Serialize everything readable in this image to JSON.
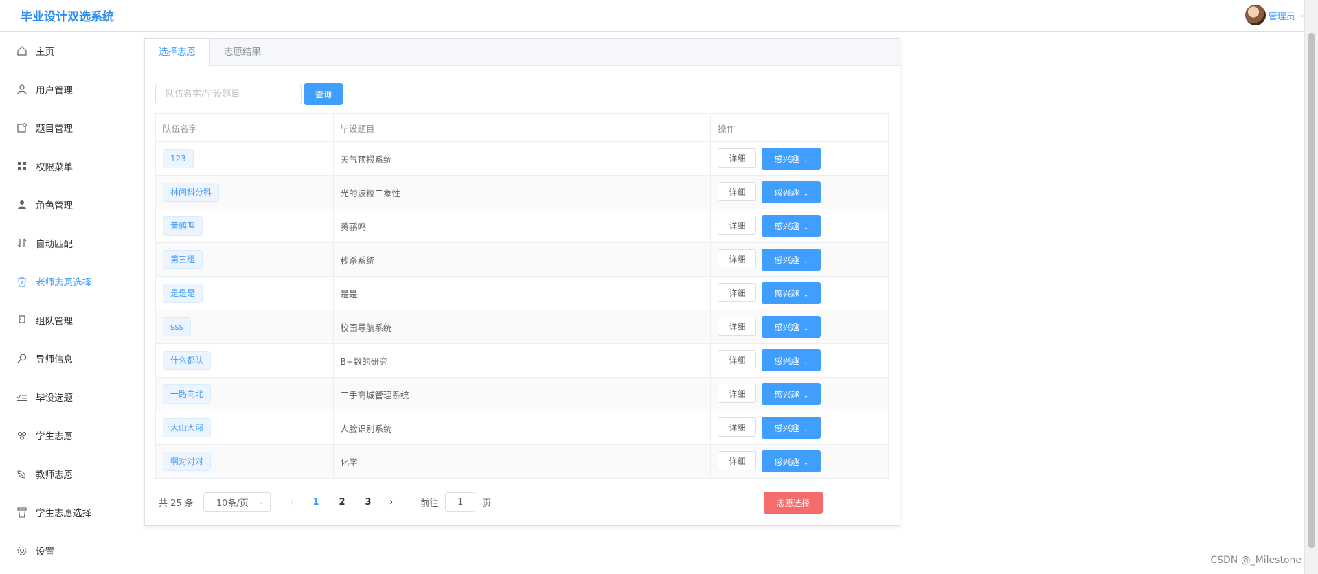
{
  "header": {
    "app_title": "毕业设计双选系统",
    "user_name": "管理员",
    "user_caret_icon": "chevron-down-icon"
  },
  "sidebar": {
    "items": [
      {
        "label": "主页",
        "icon": "home-icon"
      },
      {
        "label": "用户管理",
        "icon": "user-icon"
      },
      {
        "label": "题目管理",
        "icon": "document-icon"
      },
      {
        "label": "权限菜单",
        "icon": "grid-icon"
      },
      {
        "label": "角色管理",
        "icon": "person-filled-icon"
      },
      {
        "label": "自动匹配",
        "icon": "sort-icon"
      },
      {
        "label": "老师志愿选择",
        "icon": "trash-cup-icon",
        "active": true
      },
      {
        "label": "组队管理",
        "icon": "cup-icon"
      },
      {
        "label": "导师信息",
        "icon": "search-zoom-icon"
      },
      {
        "label": "毕设选题",
        "icon": "checklist-icon"
      },
      {
        "label": "学生志愿",
        "icon": "cherries-icon"
      },
      {
        "label": "教师志愿",
        "icon": "leaf-icon"
      },
      {
        "label": "学生志愿选择",
        "icon": "bucket-icon"
      },
      {
        "label": "设置",
        "icon": "gear-icon"
      }
    ]
  },
  "tabs": [
    {
      "label": "选择志愿",
      "active": true
    },
    {
      "label": "志愿结果",
      "active": false
    }
  ],
  "search": {
    "placeholder": "队伍名字/毕设题目",
    "value": "",
    "button_label": "查询"
  },
  "table": {
    "columns": [
      "队伍名字",
      "毕设题目",
      "操作"
    ],
    "rows": [
      {
        "team": "123",
        "topic": "天气预报系统"
      },
      {
        "team": "林间科分科",
        "topic": "光的波粒二象性"
      },
      {
        "team": "黄鹂鸣",
        "topic": "黄鹂鸣"
      },
      {
        "team": "第三组",
        "topic": "秒杀系统"
      },
      {
        "team": "是是是",
        "topic": "是是"
      },
      {
        "team": "sss",
        "topic": "校园导航系统"
      },
      {
        "team": "什么都队",
        "topic": "B+数的研究"
      },
      {
        "team": "一路向北",
        "topic": "二手商城管理系统"
      },
      {
        "team": "大山大河",
        "topic": "人脸识别系统"
      },
      {
        "team": "啊对对对",
        "topic": "化学"
      }
    ],
    "detail_label": "详细",
    "interest_label": "感兴趣"
  },
  "pagination": {
    "total_text": "共 25 条",
    "page_size": "10条/页",
    "pages": [
      "1",
      "2",
      "3"
    ],
    "current_page": "1",
    "goto_prefix": "前往",
    "goto_value": "1",
    "goto_suffix": "页"
  },
  "action_button": "志愿选择",
  "watermark": "CSDN @_Milestone",
  "colors": {
    "primary": "#409eff",
    "danger": "#f56c6c",
    "brand": "#2d8cf0"
  }
}
